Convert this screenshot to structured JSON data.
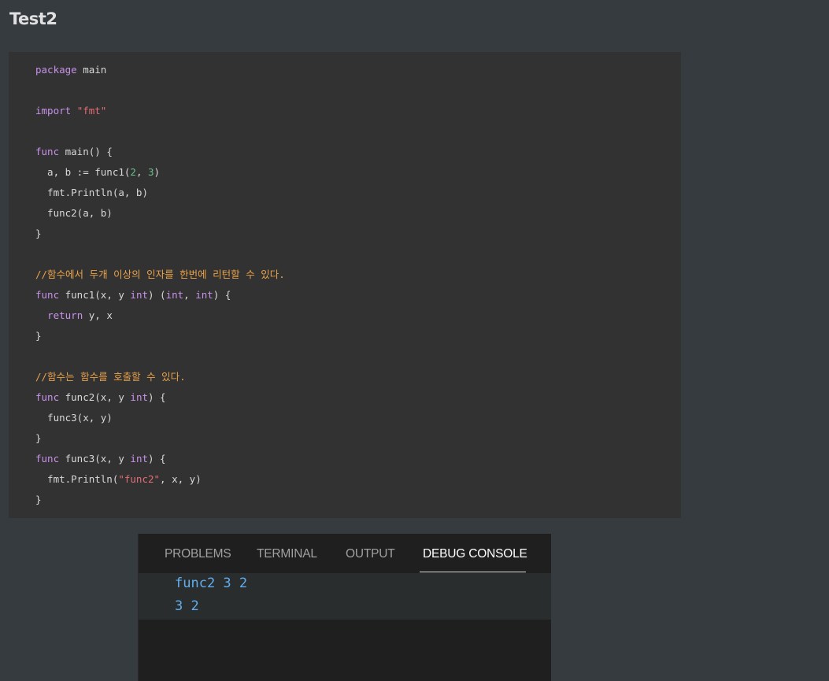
{
  "page": {
    "title": "Test2"
  },
  "code": {
    "lines": [
      [
        {
          "t": "package",
          "c": "keyword"
        },
        {
          "t": " main",
          "c": "plain"
        }
      ],
      [],
      [
        {
          "t": "import",
          "c": "keyword"
        },
        {
          "t": " ",
          "c": "plain"
        },
        {
          "t": "\"fmt\"",
          "c": "string"
        }
      ],
      [],
      [
        {
          "t": "func",
          "c": "keyword"
        },
        {
          "t": " main() {",
          "c": "plain"
        }
      ],
      [
        {
          "t": "  a, b := func1(",
          "c": "plain"
        },
        {
          "t": "2",
          "c": "number"
        },
        {
          "t": ", ",
          "c": "plain"
        },
        {
          "t": "3",
          "c": "number"
        },
        {
          "t": ")",
          "c": "plain"
        }
      ],
      [
        {
          "t": "  fmt.Println(a, b)",
          "c": "plain"
        }
      ],
      [
        {
          "t": "  func2(a, b)",
          "c": "plain"
        }
      ],
      [
        {
          "t": "}",
          "c": "plain"
        }
      ],
      [],
      [
        {
          "t": "//함수에서 두개 이상의 인자를 한번에 리턴할 수 있다.",
          "c": "comment"
        }
      ],
      [
        {
          "t": "func",
          "c": "keyword"
        },
        {
          "t": " func1(x, y ",
          "c": "plain"
        },
        {
          "t": "int",
          "c": "keyword"
        },
        {
          "t": ") (",
          "c": "plain"
        },
        {
          "t": "int",
          "c": "keyword"
        },
        {
          "t": ", ",
          "c": "plain"
        },
        {
          "t": "int",
          "c": "keyword"
        },
        {
          "t": ") {",
          "c": "plain"
        }
      ],
      [
        {
          "t": "  ",
          "c": "plain"
        },
        {
          "t": "return",
          "c": "keyword"
        },
        {
          "t": " y, x",
          "c": "plain"
        }
      ],
      [
        {
          "t": "}",
          "c": "plain"
        }
      ],
      [],
      [
        {
          "t": "//함수는 함수를 호출할 수 있다.",
          "c": "comment"
        }
      ],
      [
        {
          "t": "func",
          "c": "keyword"
        },
        {
          "t": " func2(x, y ",
          "c": "plain"
        },
        {
          "t": "int",
          "c": "keyword"
        },
        {
          "t": ") {",
          "c": "plain"
        }
      ],
      [
        {
          "t": "  func3(x, y)",
          "c": "plain"
        }
      ],
      [
        {
          "t": "}",
          "c": "plain"
        }
      ],
      [
        {
          "t": "func",
          "c": "keyword"
        },
        {
          "t": " func3(x, y ",
          "c": "plain"
        },
        {
          "t": "int",
          "c": "keyword"
        },
        {
          "t": ") {",
          "c": "plain"
        }
      ],
      [
        {
          "t": "  fmt.Println(",
          "c": "plain"
        },
        {
          "t": "\"func2\"",
          "c": "string"
        },
        {
          "t": ", x, y)",
          "c": "plain"
        }
      ],
      [
        {
          "t": "}",
          "c": "plain"
        }
      ]
    ]
  },
  "panel": {
    "tabs": {
      "problems": "PROBLEMS",
      "terminal": "TERMINAL",
      "output": "OUTPUT",
      "debug_console": "DEBUG CONSOLE"
    },
    "active_tab": "DEBUG CONSOLE",
    "output_lines": [
      "func2 3 2",
      "3 2"
    ]
  },
  "colors": {
    "page_background": "#363b40",
    "code_background": "#333232",
    "keyword": "#c792ea",
    "string": "#e06c75",
    "number": "#6bbd8c",
    "comment": "#e8a24a",
    "console_text": "#61aeee",
    "panel_background": "#1f1f1f"
  }
}
